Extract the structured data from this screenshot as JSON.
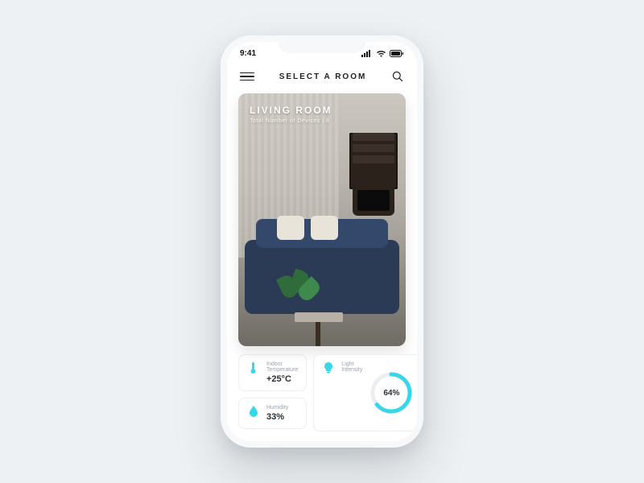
{
  "statusbar": {
    "time": "9:41"
  },
  "header": {
    "title": "SELECT A ROOM"
  },
  "room": {
    "name": "LIVING ROOM",
    "devices_label": "Total Number of Devices | 8"
  },
  "tiles": {
    "temperature": {
      "label": "Indoor Temperature",
      "value": "+25°C"
    },
    "humidity": {
      "label": "Humidity",
      "value": "33%"
    },
    "light": {
      "label": "Light Intensity",
      "value": "64%",
      "percent": 64
    }
  },
  "colors": {
    "accent": "#38d7e7"
  }
}
